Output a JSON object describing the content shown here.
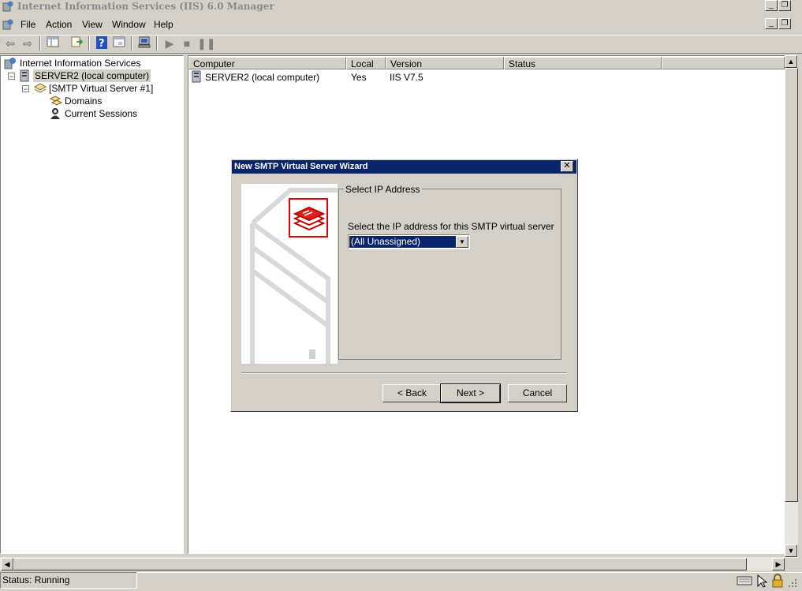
{
  "window": {
    "title": "Internet Information Services (IIS) 6.0 Manager"
  },
  "menu": [
    "File",
    "Action",
    "View",
    "Window",
    "Help"
  ],
  "tree": {
    "root": "Internet Information Services",
    "server": "SERVER2 (local computer)",
    "smtp": "[SMTP Virtual Server #1]",
    "domains": "Domains",
    "sessions": "Current Sessions"
  },
  "list": {
    "columns": [
      "Computer",
      "Local",
      "Version",
      "Status"
    ],
    "rows": [
      {
        "computer": "SERVER2 (local computer)",
        "local": "Yes",
        "version": "IIS V7.5",
        "status": ""
      }
    ]
  },
  "status": {
    "text": "Status: Running"
  },
  "dialog": {
    "title": "New SMTP Virtual Server Wizard",
    "group_label": "Select IP Address",
    "prompt": "Select the IP address for this SMTP virtual server",
    "ip_value": "(All Unassigned)",
    "back_label": "< Back",
    "next_label": "Next >",
    "cancel_label": "Cancel"
  },
  "colors": {
    "dialog_title_bg": "#0a246a",
    "accent_red": "#e00000"
  }
}
